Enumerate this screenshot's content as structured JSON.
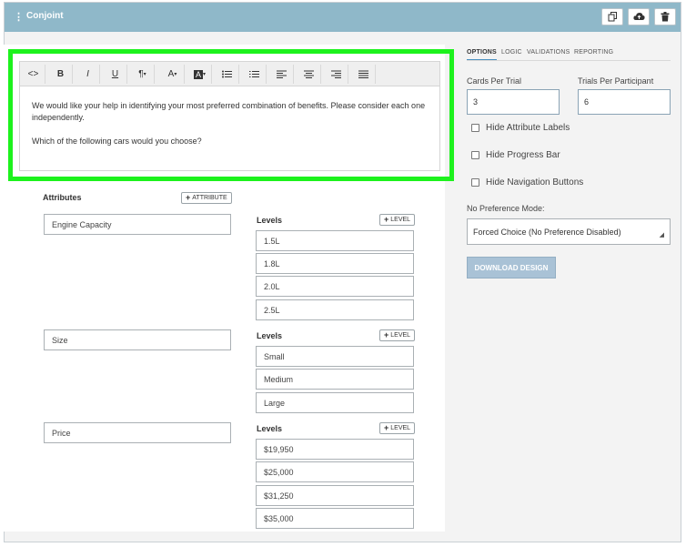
{
  "header": {
    "drag_glyph": "⋮",
    "title": "Conjoint",
    "icons": [
      "copy-icon",
      "cloud-upload-icon",
      "trash-icon"
    ]
  },
  "editor": {
    "toolbar": [
      "<>",
      "B",
      "I",
      "U",
      "¶",
      "A",
      "A",
      "bullet-list",
      "numbered-list",
      "align-left",
      "align-center",
      "align-right",
      "justify"
    ],
    "paragraph_1": "We would like your help in identifying your most preferred combination of benefits. Please consider each one independently.",
    "paragraph_2": "Which of the following cars would you choose?"
  },
  "attributes": {
    "label": "Attributes",
    "add_attribute": "ATTRIBUTE",
    "levels_label": "Levels",
    "add_level": "LEVEL",
    "items": [
      {
        "name": "Engine Capacity",
        "levels": [
          "1.5L",
          "1.8L",
          "2.0L",
          "2.5L"
        ]
      },
      {
        "name": "Size",
        "levels": [
          "Small",
          "Medium",
          "Large"
        ]
      },
      {
        "name": "Price",
        "levels": [
          "$19,950",
          "$25,000",
          "$31,250",
          "$35,000"
        ]
      }
    ]
  },
  "sidebar": {
    "tabs": [
      "OPTIONS",
      "LOGIC",
      "VALIDATIONS",
      "REPORTING"
    ],
    "active_tab": "OPTIONS",
    "cards_per_trial_label": "Cards Per Trial",
    "cards_per_trial_value": "3",
    "trials_per_participant_label": "Trials Per Participant",
    "trials_per_participant_value": "6",
    "checkboxes": [
      "Hide Attribute Labels",
      "Hide Progress Bar",
      "Hide Navigation Buttons"
    ],
    "no_pref_label": "No Preference Mode:",
    "no_pref_value": "Forced Choice (No Preference Disabled)",
    "download_label": "DOWNLOAD DESIGN"
  },
  "colors": {
    "header": "#8fb8c9",
    "highlight": "#1df21d",
    "download_button": "#a9c2d6"
  }
}
